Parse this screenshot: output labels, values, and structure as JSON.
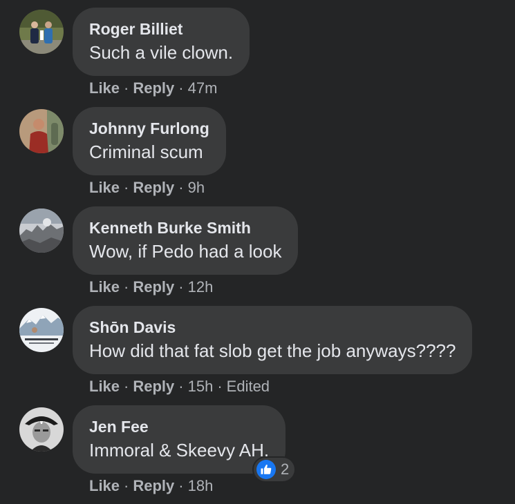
{
  "comments": [
    {
      "author": "Roger Billiet",
      "text": "Such a vile clown.",
      "like_label": "Like",
      "reply_label": "Reply",
      "time": "47m",
      "avatar_icon": "avatar-photo-icon"
    },
    {
      "author": "Johnny Furlong",
      "text": "Criminal scum",
      "like_label": "Like",
      "reply_label": "Reply",
      "time": "9h",
      "avatar_icon": "avatar-photo-icon"
    },
    {
      "author": "Kenneth Burke Smith",
      "text": "Wow, if Pedo had a look",
      "like_label": "Like",
      "reply_label": "Reply",
      "time": "12h",
      "avatar_icon": "avatar-photo-icon"
    },
    {
      "author": "Shōn Davis",
      "text": "How did that fat slob get the job anyways????",
      "like_label": "Like",
      "reply_label": "Reply",
      "time": "15h",
      "edited_label": "Edited",
      "avatar_icon": "avatar-photo-icon"
    },
    {
      "author": "Jen Fee",
      "text": "Immoral & Skeevy AH.",
      "like_label": "Like",
      "reply_label": "Reply",
      "time": "18h",
      "avatar_icon": "avatar-photo-icon",
      "reaction": {
        "icon": "thumbs-up-icon",
        "count": "2"
      }
    }
  ],
  "colors": {
    "background": "#242526",
    "bubble": "#3a3b3c",
    "primary_text": "#e4e6eb",
    "secondary_text": "#b0b3b8",
    "like_blue": "#1877f2"
  }
}
